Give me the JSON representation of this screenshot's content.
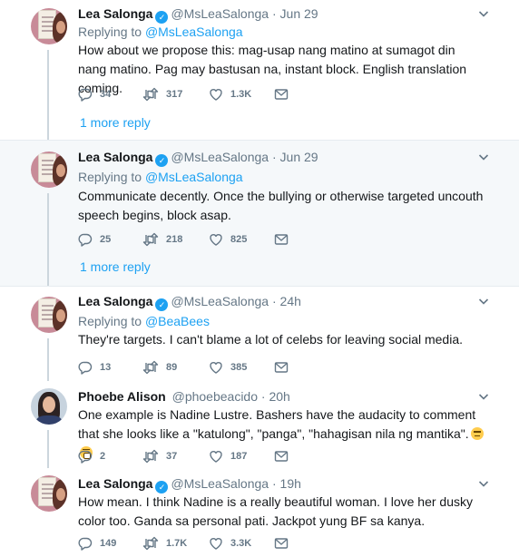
{
  "tweets": [
    {
      "name": "Lea Salonga",
      "verified": true,
      "handle": "@MsLeaSalonga",
      "time": "Jun 29",
      "replying_label": "Replying to",
      "replying_to": "@MsLeaSalonga",
      "text": "How about we propose this: mag-usap nang matino at sumagot din nang matino. Pag may bastusan na, instant block. English translation coming.",
      "replies": "34",
      "retweets": "317",
      "likes": "1.3K",
      "more_replies": "1 more reply"
    },
    {
      "name": "Lea Salonga",
      "verified": true,
      "handle": "@MsLeaSalonga",
      "time": "Jun 29",
      "replying_label": "Replying to",
      "replying_to": "@MsLeaSalonga",
      "text": "Communicate decently. Once the bullying or otherwise targeted uncouth speech begins, block asap.",
      "replies": "25",
      "retweets": "218",
      "likes": "825",
      "more_replies": "1 more reply"
    },
    {
      "name": "Lea Salonga",
      "verified": true,
      "handle": "@MsLeaSalonga",
      "time": "24h",
      "replying_label": "Replying to",
      "replying_to": "@BeaBees",
      "text": "They're targets. I can't blame a lot of celebs for leaving social media.",
      "replies": "13",
      "retweets": "89",
      "likes": "385"
    },
    {
      "name": "Phoebe Alison",
      "verified": false,
      "handle": "@phoebeacido",
      "time": "20h",
      "text": "One example is Nadine Lustre. Bashers have the audacity to comment that she looks like a \"katulong\", \"panga\", \"hahagisan nila ng mantika\".",
      "replies": "2",
      "retweets": "37",
      "likes": "187"
    },
    {
      "name": "Lea Salonga",
      "verified": true,
      "handle": "@MsLeaSalonga",
      "time": "19h",
      "text": "How mean. I think Nadine is a really beautiful woman. I love her dusky color too. Ganda sa personal pati. Jackpot yung BF sa kanya.",
      "replies": "149",
      "retweets": "1.7K",
      "likes": "3.3K"
    }
  ],
  "separator": "·",
  "icons": [
    "reply-icon",
    "retweet-icon",
    "like-icon",
    "direct-message-icon",
    "chevron-down-icon",
    "verified-badge"
  ],
  "colors": {
    "accent": "#1da1f2",
    "muted": "#657786",
    "text": "#14171a",
    "highlight_bg": "#f5f8fa",
    "border": "#e6ecf0"
  }
}
